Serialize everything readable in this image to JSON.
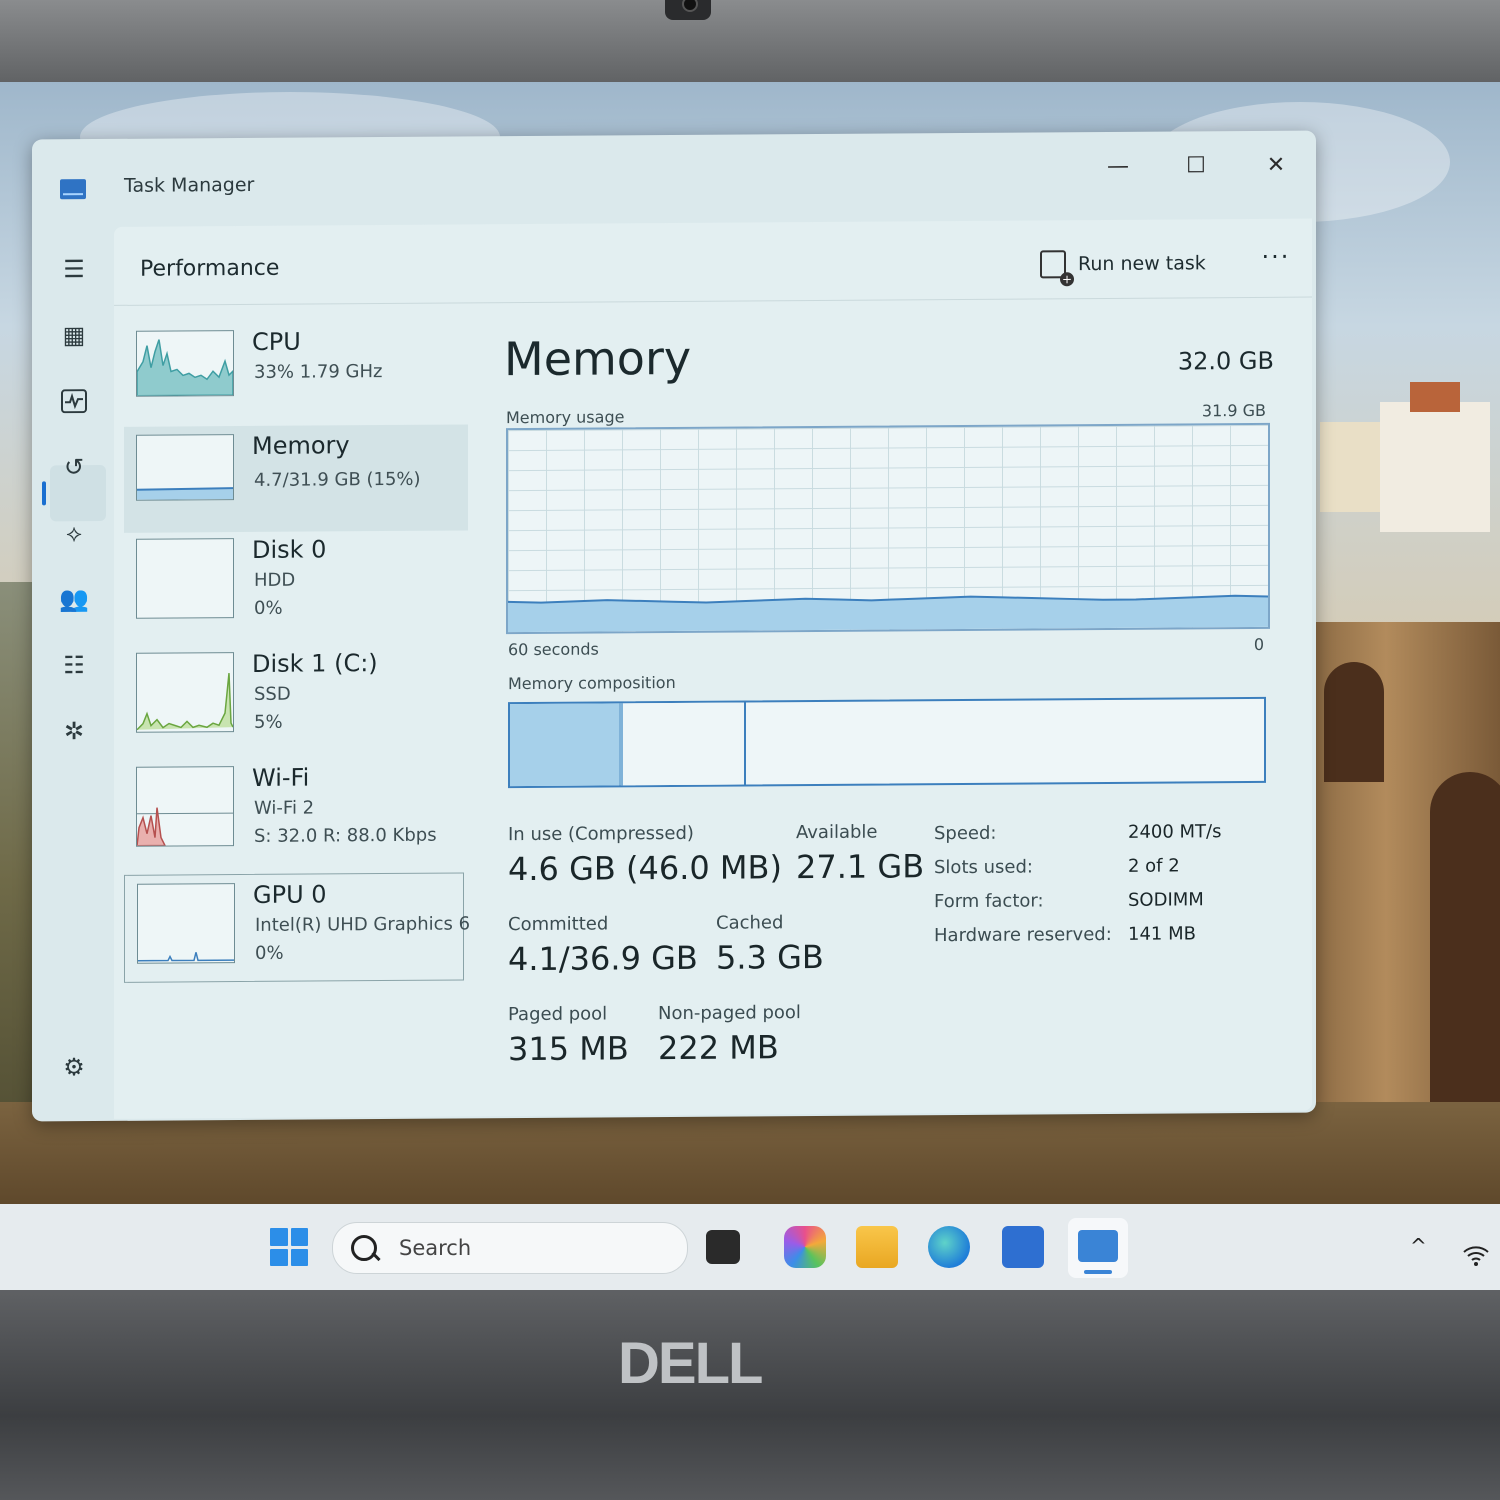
{
  "window": {
    "title": "Task Manager",
    "minimize": "—",
    "maximize": "☐",
    "close": "✕"
  },
  "header": {
    "page_title": "Performance",
    "run_new_task": "Run new task",
    "more": "···"
  },
  "devices": [
    {
      "name": "CPU",
      "line1": "33%  1.79 GHz",
      "line2": ""
    },
    {
      "name": "Memory",
      "line1": "4.7/31.9 GB (15%)",
      "line2": ""
    },
    {
      "name": "Disk 0",
      "line1": "HDD",
      "line2": "0%"
    },
    {
      "name": "Disk 1 (C:)",
      "line1": "SSD",
      "line2": "5%"
    },
    {
      "name": "Wi-Fi",
      "line1": "Wi-Fi 2",
      "line2": "S: 32.0  R: 88.0 Kbps"
    },
    {
      "name": "GPU 0",
      "line1": "Intel(R) UHD Graphics 6",
      "line2": "0%"
    }
  ],
  "detail": {
    "title": "Memory",
    "total": "32.0 GB",
    "usage_label": "Memory usage",
    "usage_max": "31.9 GB",
    "time_left": "60 seconds",
    "time_right": "0",
    "composition_label": "Memory composition",
    "usage_fraction": 0.15,
    "composition": {
      "in_use_fraction": 0.145,
      "modified_fraction": 0.005,
      "standby_fraction": 0.16
    },
    "stats": {
      "in_use_label": "In use (Compressed)",
      "in_use_value": "4.6 GB (46.0 MB)",
      "available_label": "Available",
      "available_value": "27.1 GB",
      "committed_label": "Committed",
      "committed_value": "4.1/36.9 GB",
      "cached_label": "Cached",
      "cached_value": "5.3 GB",
      "paged_label": "Paged pool",
      "paged_value": "315 MB",
      "nonpaged_label": "Non-paged pool",
      "nonpaged_value": "222 MB"
    },
    "specs": [
      {
        "label": "Speed:",
        "value": "2400 MT/s"
      },
      {
        "label": "Slots used:",
        "value": "2 of 2"
      },
      {
        "label": "Form factor:",
        "value": "SODIMM"
      },
      {
        "label": "Hardware reserved:",
        "value": "141 MB"
      }
    ]
  },
  "taskbar": {
    "search_placeholder": "Search",
    "tray_chevron": "^",
    "wifi": "wifi-icon"
  },
  "brand": "DELL",
  "colors": {
    "memory_fill": "#a6d0ea",
    "memory_line": "#3c7fbd",
    "cpu": "#4aa3a8",
    "disk": "#6aa640",
    "wifi": "#b5504f",
    "accent": "#1a6fd0"
  }
}
